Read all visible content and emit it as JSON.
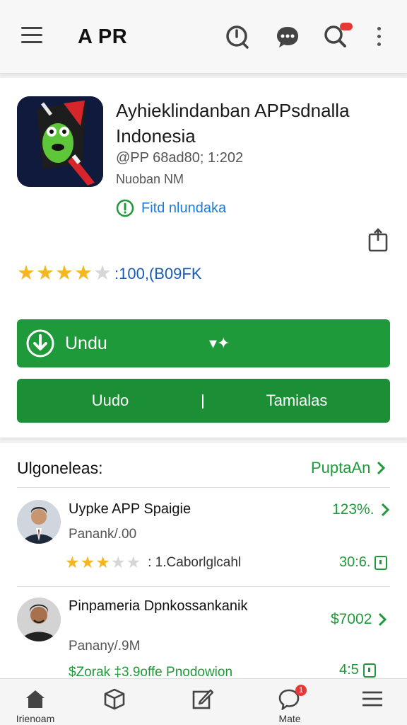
{
  "header": {
    "title": "A PR",
    "icons": [
      "menu-icon",
      "history-icon",
      "chat-icon",
      "search-icon",
      "more-vert-icon"
    ]
  },
  "app": {
    "name": "Ayhieklindanban APPsdnalla Indonesia",
    "meta_line1": "@PP 68ad80; 1:202",
    "meta_line2": "Nuoban NM",
    "verified_label": "Fitd nlundaka",
    "rating_stars": 4,
    "rating_max": 5,
    "rating_text": ":100,(B09FK",
    "install_label": "Undu",
    "install_extra": "▾✦",
    "button_left_label": "Uudo",
    "button_right_label": "Tamialas"
  },
  "suggestions": {
    "title": "Ulgoneleas:",
    "more_label": "PuptaAn",
    "items": [
      {
        "name": "Uypke APP Spaigie",
        "sub": "Panank/.00",
        "value": "123%.",
        "rating_stars": 3,
        "rating_text": ": 1.Caborlglcahl",
        "value2": "30:6."
      },
      {
        "name": "Pinpameria Dpnkossankanik",
        "sub": "Panany/.9M",
        "value": "$7002",
        "extra": "$Zorak ‡3.9offe Pnodowion",
        "value2": "4:5"
      }
    ]
  },
  "bottom_nav": [
    {
      "label": "Irienoam",
      "icon": "home-icon"
    },
    {
      "label": "",
      "icon": "box-icon"
    },
    {
      "label": "",
      "icon": "edit-icon"
    },
    {
      "label": "Mate",
      "icon": "chat-bubble-icon",
      "badge": "1"
    },
    {
      "label": "",
      "icon": "menu-lines-icon"
    }
  ],
  "colors": {
    "accent_green": "#1f9a3a",
    "link_blue": "#1b7bd6",
    "star_gold": "#f5b623",
    "badge_red": "#e53935"
  }
}
